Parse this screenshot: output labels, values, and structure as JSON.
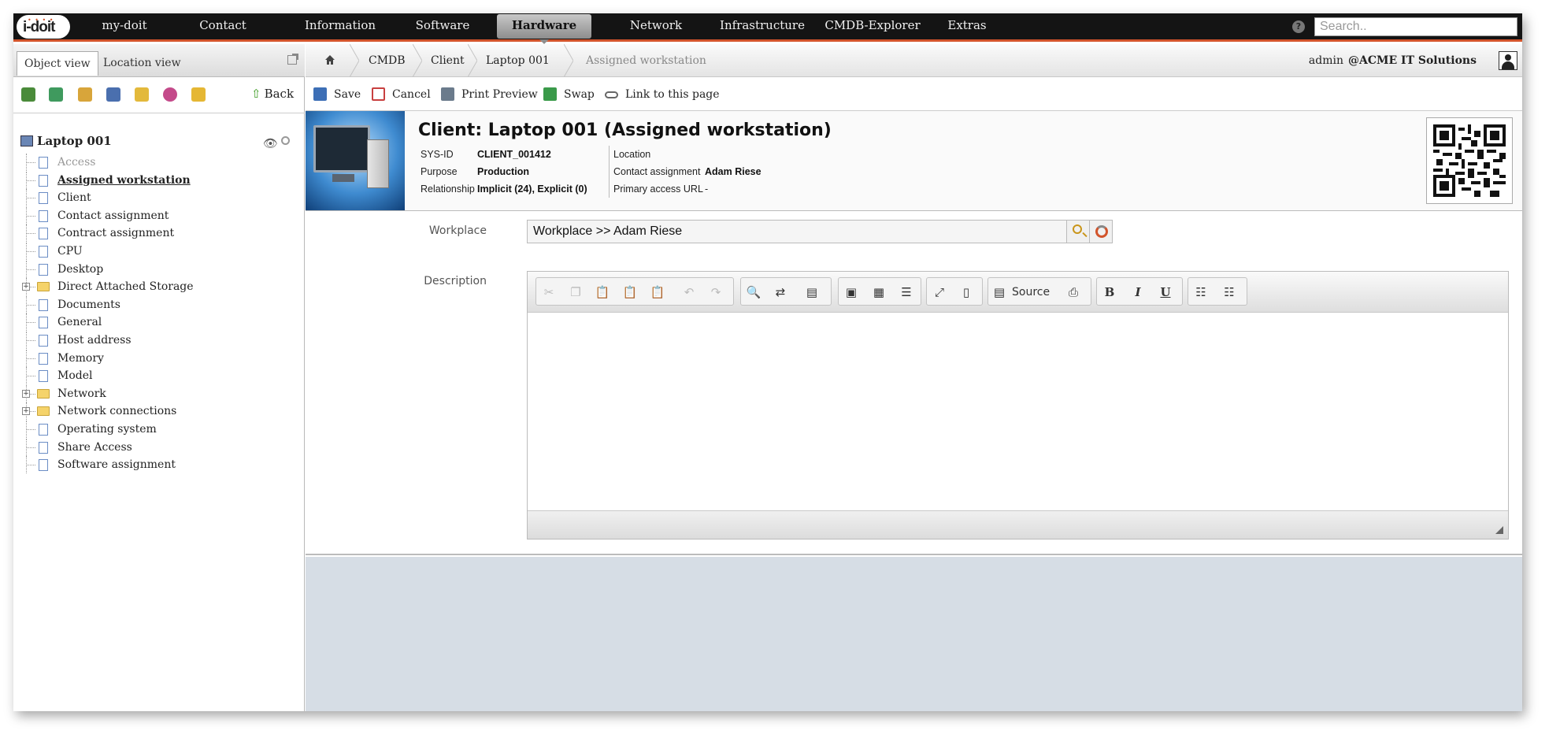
{
  "logo": {
    "text": "i-doit"
  },
  "nav": {
    "items": [
      {
        "label": "my-doit",
        "active": false
      },
      {
        "label": "Contact",
        "active": false
      },
      {
        "label": "Information",
        "active": false
      },
      {
        "label": "Software",
        "active": false
      },
      {
        "label": "Hardware",
        "active": true
      },
      {
        "label": "Network",
        "active": false
      },
      {
        "label": "Infrastructure",
        "active": false
      },
      {
        "label": "CMDB-Explorer",
        "active": false
      },
      {
        "label": "Extras",
        "active": false
      }
    ],
    "search_placeholder": "Search..",
    "help_icon": "help-icon"
  },
  "left": {
    "tabs": [
      {
        "label": "Object view",
        "active": true
      },
      {
        "label": "Location view",
        "active": false
      }
    ],
    "back_label": "Back",
    "tool_icons": [
      "tree-icon",
      "expand-icon",
      "list-icon",
      "book-icon",
      "shield-icon",
      "globe-icon",
      "lock-icon"
    ],
    "tree_root": "Laptop 001",
    "tree": [
      {
        "label": "Access",
        "type": "doc",
        "dim": true
      },
      {
        "label": "Assigned workstation",
        "type": "doc",
        "current": true
      },
      {
        "label": "Client",
        "type": "doc"
      },
      {
        "label": "Contact assignment",
        "type": "doc"
      },
      {
        "label": "Contract assignment",
        "type": "doc"
      },
      {
        "label": "CPU",
        "type": "doc"
      },
      {
        "label": "Desktop",
        "type": "doc"
      },
      {
        "label": "Direct Attached Storage",
        "type": "folder"
      },
      {
        "label": "Documents",
        "type": "doc"
      },
      {
        "label": "General",
        "type": "doc"
      },
      {
        "label": "Host address",
        "type": "doc"
      },
      {
        "label": "Memory",
        "type": "doc"
      },
      {
        "label": "Model",
        "type": "doc"
      },
      {
        "label": "Network",
        "type": "folder"
      },
      {
        "label": "Network connections",
        "type": "folder"
      },
      {
        "label": "Operating system",
        "type": "doc"
      },
      {
        "label": "Share Access",
        "type": "doc"
      },
      {
        "label": "Software assignment",
        "type": "doc"
      }
    ]
  },
  "breadcrumb": {
    "items": [
      "CMDB",
      "Client",
      "Laptop 001",
      "Assigned workstation"
    ],
    "user": "admin",
    "tenant": "@ACME IT Solutions"
  },
  "actions": [
    {
      "label": "Save",
      "icon": "save-icon",
      "color": "#3d6fb6"
    },
    {
      "label": "Cancel",
      "icon": "cancel-icon",
      "color": "#c84040"
    },
    {
      "label": "Print Preview",
      "icon": "print-icon",
      "color": "#6b7b8c"
    },
    {
      "label": "Swap",
      "icon": "swap-icon",
      "color": "#3a9a4a"
    },
    {
      "label": "Link to this page",
      "icon": "link-icon",
      "color": "#666666"
    }
  ],
  "object": {
    "title": "Client: Laptop 001 (Assigned workstation)",
    "sysid_label": "SYS-ID",
    "sysid": "CLIENT_001412",
    "purpose_label": "Purpose",
    "purpose": "Production",
    "relationship_label": "Relationship",
    "relationship": "Implicit (24), Explicit (0)",
    "location_label": "Location",
    "location": "",
    "contact_label": "Contact assignment",
    "contact": "Adam Riese",
    "url_label": "Primary access URL",
    "url": "-"
  },
  "form": {
    "workplace_label": "Workplace",
    "workplace_value": "Workplace >> Adam Riese",
    "description_label": "Description",
    "source_label": "Source",
    "bold_label": "B",
    "italic_label": "I",
    "underline_label": "U"
  },
  "colors": {
    "accent": "#d2542b",
    "nav_bg": "#141414",
    "content_bg": "#d6dde5"
  }
}
